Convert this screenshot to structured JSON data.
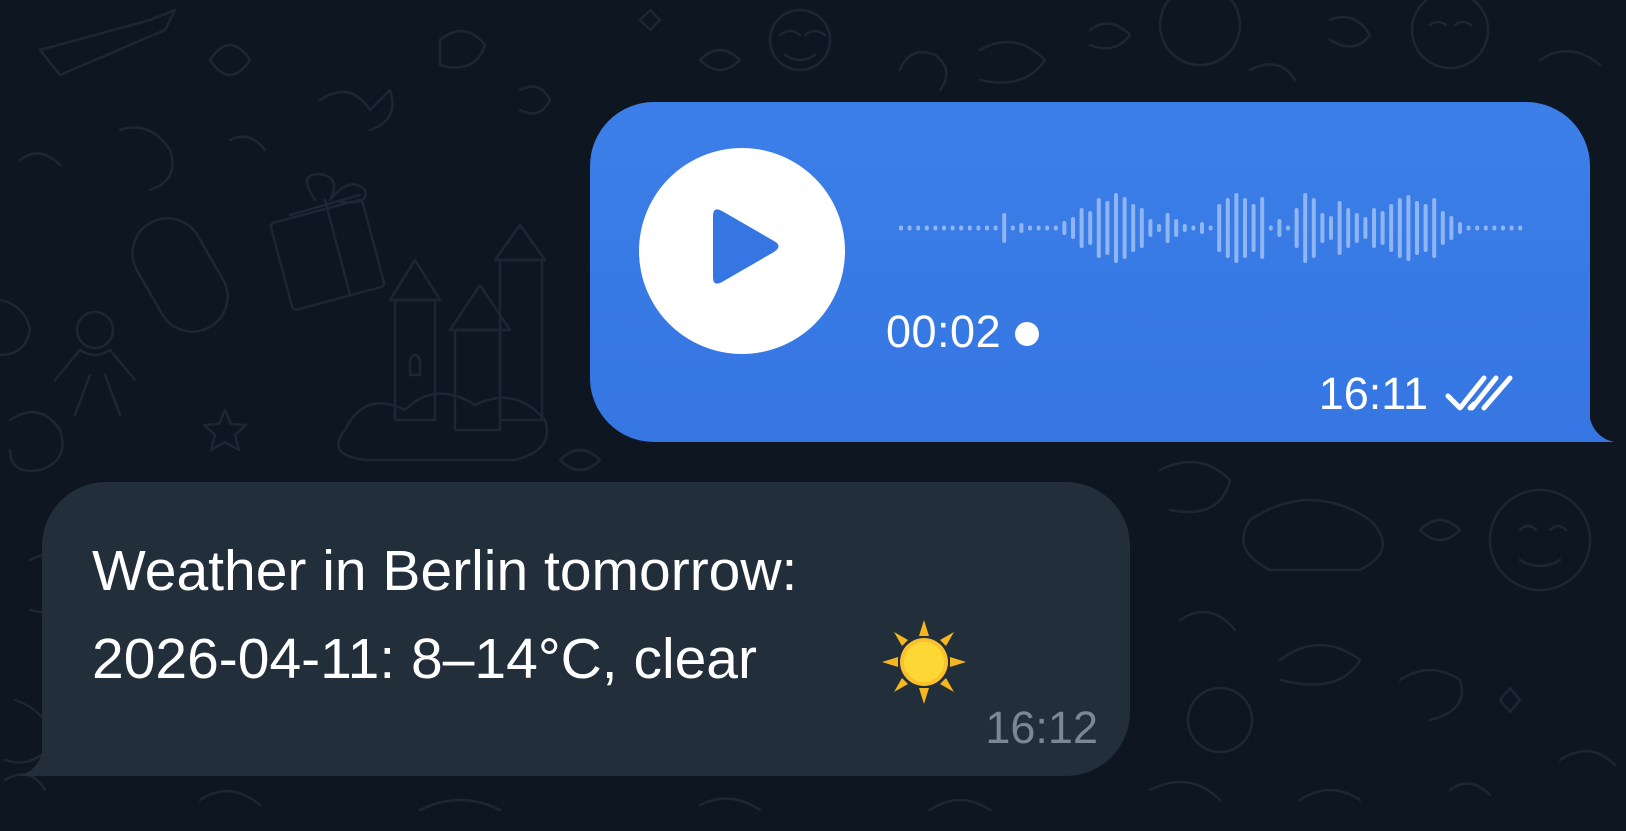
{
  "colors": {
    "chat_background": "#0e1621",
    "outgoing_bubble": "#3a7ce6",
    "incoming_bubble": "#222e3a",
    "incoming_time": "#7b8794"
  },
  "outgoing_voice": {
    "play_icon": "play-icon",
    "duration": "00:02",
    "unplayed_indicator": "dot",
    "time": "16:11",
    "status_icon": "double-check-icon",
    "status": "read"
  },
  "incoming_text": {
    "line1": "Weather in Berlin tomorrow:",
    "line2": "2026-04-11: 8–14°C, clear",
    "emoji_icon": "sun-icon",
    "time": "16:12"
  }
}
